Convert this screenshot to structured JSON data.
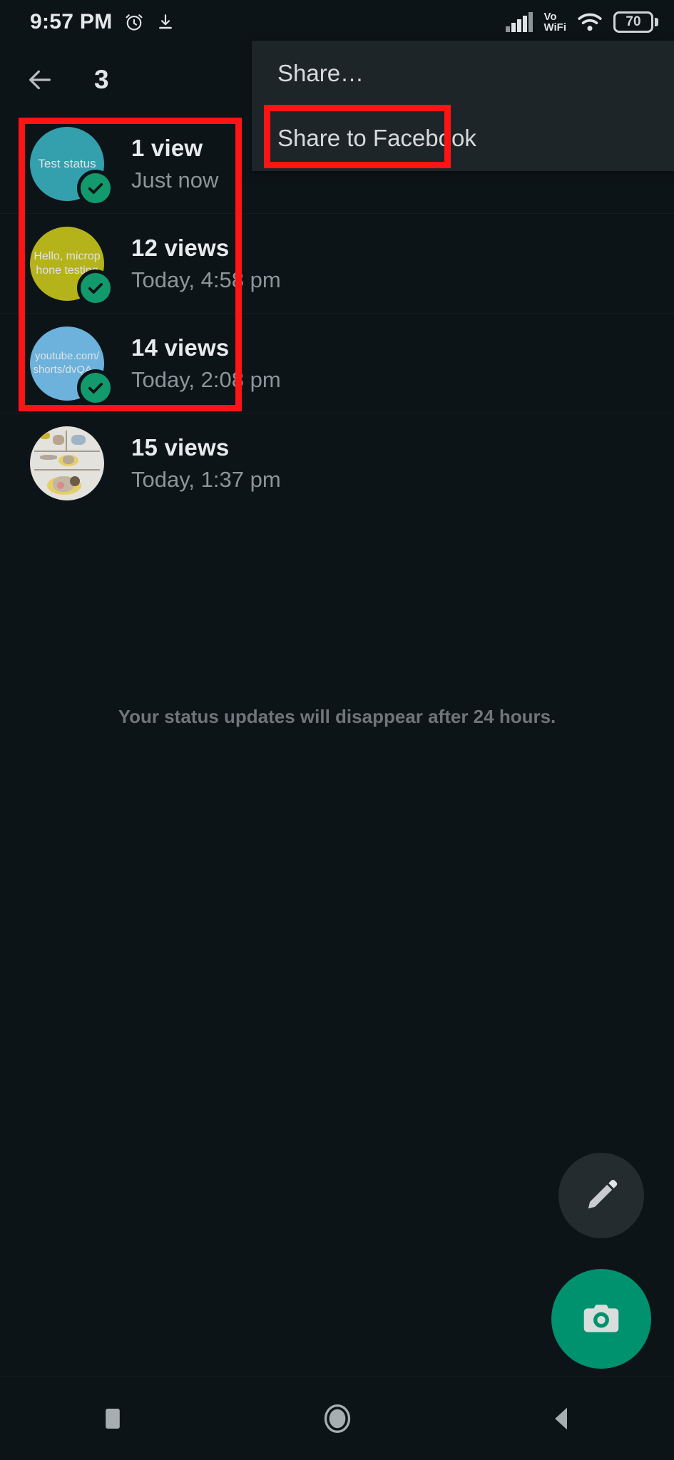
{
  "colors": {
    "background": "#0d1418",
    "menu_background": "#1e2528",
    "accent_green": "#00916f",
    "check_green": "#12996c",
    "annotation_red": "#ff1414",
    "text_primary": "#e8ebec",
    "text_secondary": "#8d9599"
  },
  "status_bar": {
    "clock": "9:57 PM",
    "alarm_icon": "alarm-clock-icon",
    "download_icon": "download-icon",
    "signal_icon": "cellular-signal-icon",
    "volte_label_top": "Vo",
    "volte_label_bottom": "WiFi",
    "wifi_icon": "wifi-icon",
    "battery_level": "70"
  },
  "app_bar": {
    "back_icon": "back-arrow-icon",
    "title": "3"
  },
  "statuses": [
    {
      "preview_text": "Test status",
      "preview_color": "#34a0ae",
      "views": "1 view",
      "time": "Just now",
      "has_check": true,
      "thumb_type": "text"
    },
    {
      "preview_text": "Hello, microphone testing",
      "preview_color": "#b5b31a",
      "views": "12 views",
      "time": "Today, 4:58 pm",
      "has_check": true,
      "thumb_type": "text"
    },
    {
      "preview_text": "youtube.com/shorts/dvQA...",
      "preview_color": "#6cb2dc",
      "views": "14 views",
      "time": "Today, 2:08 pm",
      "has_check": true,
      "thumb_type": "text"
    },
    {
      "preview_text": "",
      "preview_color": "#e3e2dd",
      "views": "15 views",
      "time": "Today, 1:37 pm",
      "has_check": false,
      "thumb_type": "image"
    }
  ],
  "disclaimer": "Your status updates will disappear after 24 hours.",
  "share_menu": {
    "items": [
      {
        "label": "Share…",
        "highlighted": false
      },
      {
        "label": "Share to Facebook",
        "highlighted": true
      }
    ]
  },
  "fabs": {
    "edit_label": "edit-status",
    "edit_icon": "pencil-icon",
    "camera_label": "new-status",
    "camera_icon": "camera-icon"
  },
  "nav_bar": {
    "recents_icon": "recents-square-icon",
    "home_icon": "home-circle-icon",
    "back_icon": "back-triangle-icon"
  }
}
